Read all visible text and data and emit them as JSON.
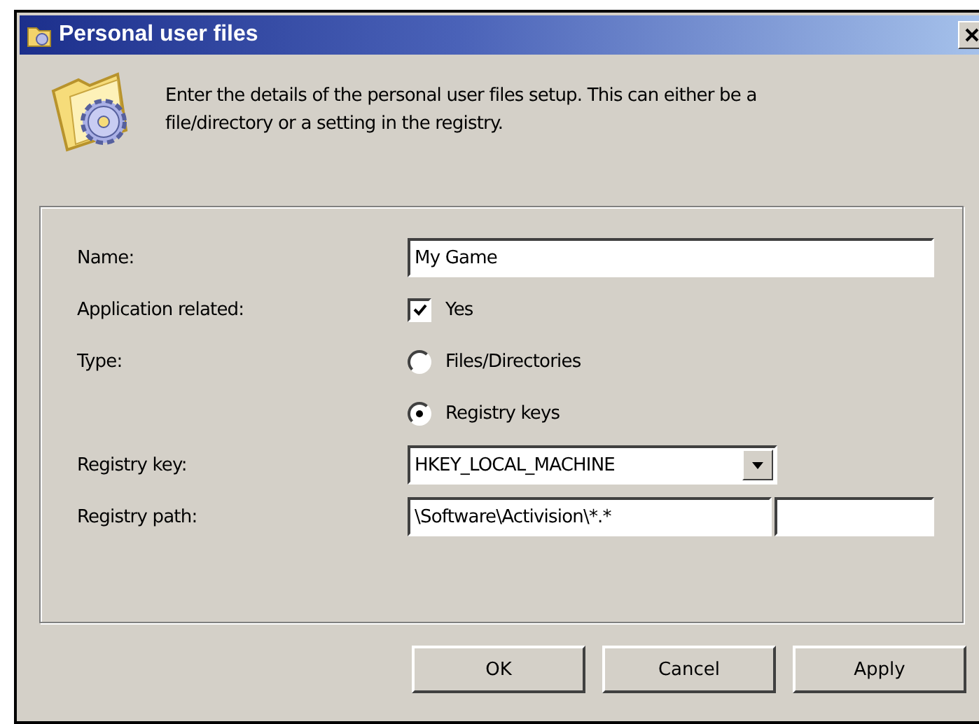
{
  "window": {
    "title": "Personal user files"
  },
  "description": "Enter the details of the personal user files setup. This can either be a file/directory or a setting in the registry.",
  "form": {
    "name": {
      "label": "Name:",
      "value": "My Game"
    },
    "application_related": {
      "label": "Application related:",
      "option": "Yes",
      "checked": true
    },
    "type": {
      "label": "Type:",
      "options": [
        {
          "label": "Files/Directories",
          "selected": false
        },
        {
          "label": "Registry keys",
          "selected": true
        }
      ]
    },
    "registry_key": {
      "label": "Registry key:",
      "value": "HKEY_LOCAL_MACHINE"
    },
    "registry_path": {
      "label": "Registry path:",
      "value": "\\Software\\Activision\\*.*"
    }
  },
  "buttons": [
    "OK",
    "Cancel",
    "Apply"
  ]
}
